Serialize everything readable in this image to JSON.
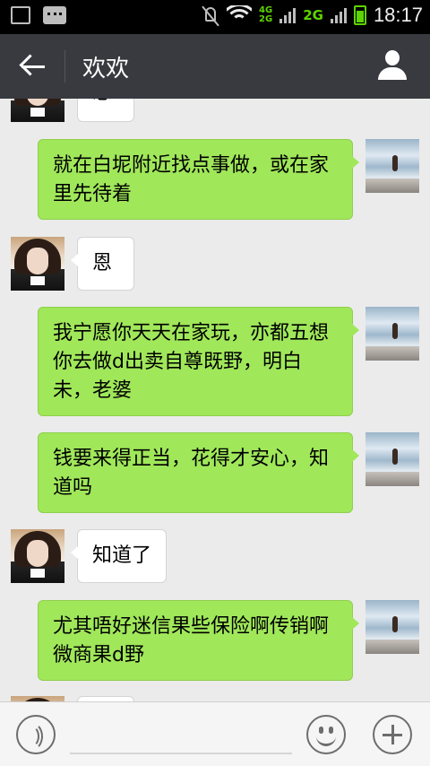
{
  "status_bar": {
    "network_top": "4G",
    "network_bottom": "2G",
    "network_2g": "2G",
    "time": "18:17"
  },
  "header": {
    "title": "欢欢"
  },
  "messages": [
    {
      "side": "left",
      "text": "恩"
    },
    {
      "side": "right",
      "text": "就在白坭附近找点事做，或在家里先待着"
    },
    {
      "side": "left",
      "text": "恩"
    },
    {
      "side": "right",
      "text": "我宁愿你天天在家玩，亦都五想你去做d出卖自尊既野，明白未，老婆"
    },
    {
      "side": "right",
      "text": "钱要来得正当，花得才安心，知道吗"
    },
    {
      "side": "left",
      "text": "知道了"
    },
    {
      "side": "right",
      "text": "尤其唔好迷信果些保险啊传销啊微商果d野"
    }
  ],
  "colors": {
    "header_bg": "#393a3f",
    "chat_bg": "#ebebeb",
    "bubble_right": "#a0e75a",
    "bubble_left": "#ffffff"
  },
  "icons": {
    "back": "back-arrow-icon",
    "profile": "person-icon",
    "voice": "voice-icon",
    "emoji": "emoji-icon",
    "more": "plus-icon"
  }
}
